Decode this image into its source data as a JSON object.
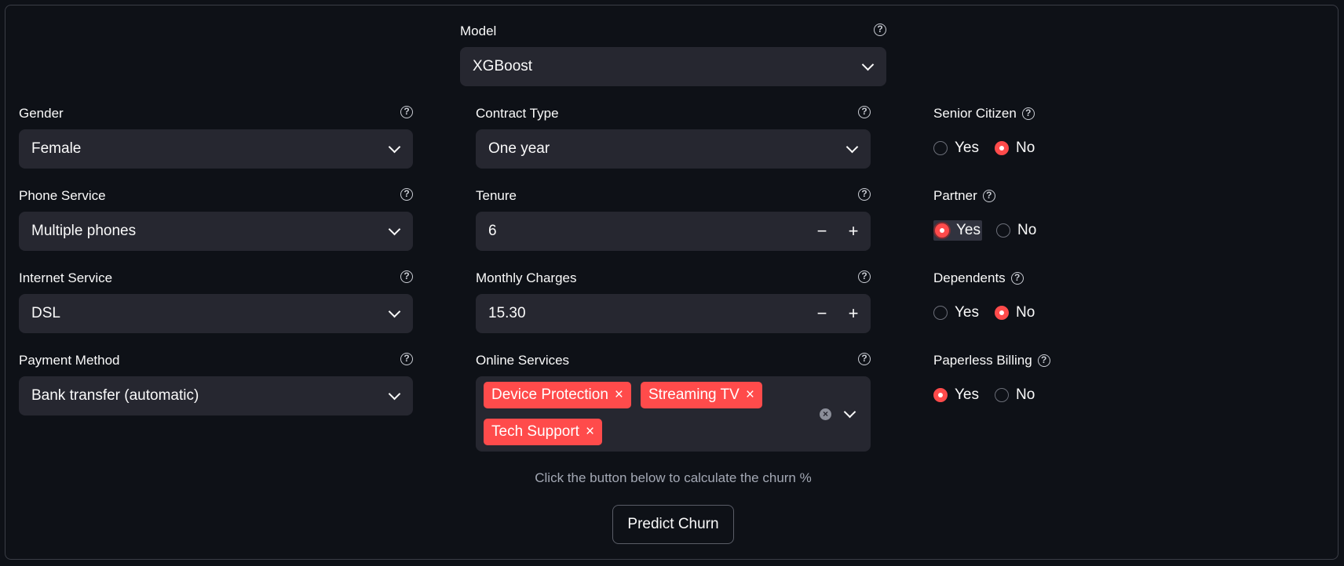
{
  "model": {
    "label": "Model",
    "value": "XGBoost"
  },
  "gender": {
    "label": "Gender",
    "value": "Female"
  },
  "contract_type": {
    "label": "Contract Type",
    "value": "One year"
  },
  "phone_service": {
    "label": "Phone Service",
    "value": "Multiple phones"
  },
  "tenure": {
    "label": "Tenure",
    "value": "6",
    "minus": "−",
    "plus": "+"
  },
  "internet_service": {
    "label": "Internet Service",
    "value": "DSL"
  },
  "monthly_charges": {
    "label": "Monthly Charges",
    "value": "15.30",
    "minus": "−",
    "plus": "+"
  },
  "payment_method": {
    "label": "Payment Method",
    "value": "Bank transfer (automatic)"
  },
  "online_services": {
    "label": "Online Services",
    "tags": [
      "Device Protection",
      "Streaming TV",
      "Tech Support"
    ],
    "remove_glyph": "×",
    "clear_glyph": "×"
  },
  "senior_citizen": {
    "label": "Senior Citizen",
    "options": [
      "Yes",
      "No"
    ],
    "selected": "No"
  },
  "partner": {
    "label": "Partner",
    "options": [
      "Yes",
      "No"
    ],
    "selected": "Yes"
  },
  "dependents": {
    "label": "Dependents",
    "options": [
      "Yes",
      "No"
    ],
    "selected": "No"
  },
  "paperless_billing": {
    "label": "Paperless Billing",
    "options": [
      "Yes",
      "No"
    ],
    "selected": "Yes"
  },
  "help_glyph": "?",
  "caption": "Click the button below to calculate the churn %",
  "predict_button": "Predict Churn",
  "colors": {
    "background": "#0e1117",
    "widget": "#262730",
    "accent": "#ff4b4b"
  },
  "icons": {
    "help": "question-circle-icon",
    "dropdown": "chevron-down-icon",
    "remove": "close-icon"
  }
}
